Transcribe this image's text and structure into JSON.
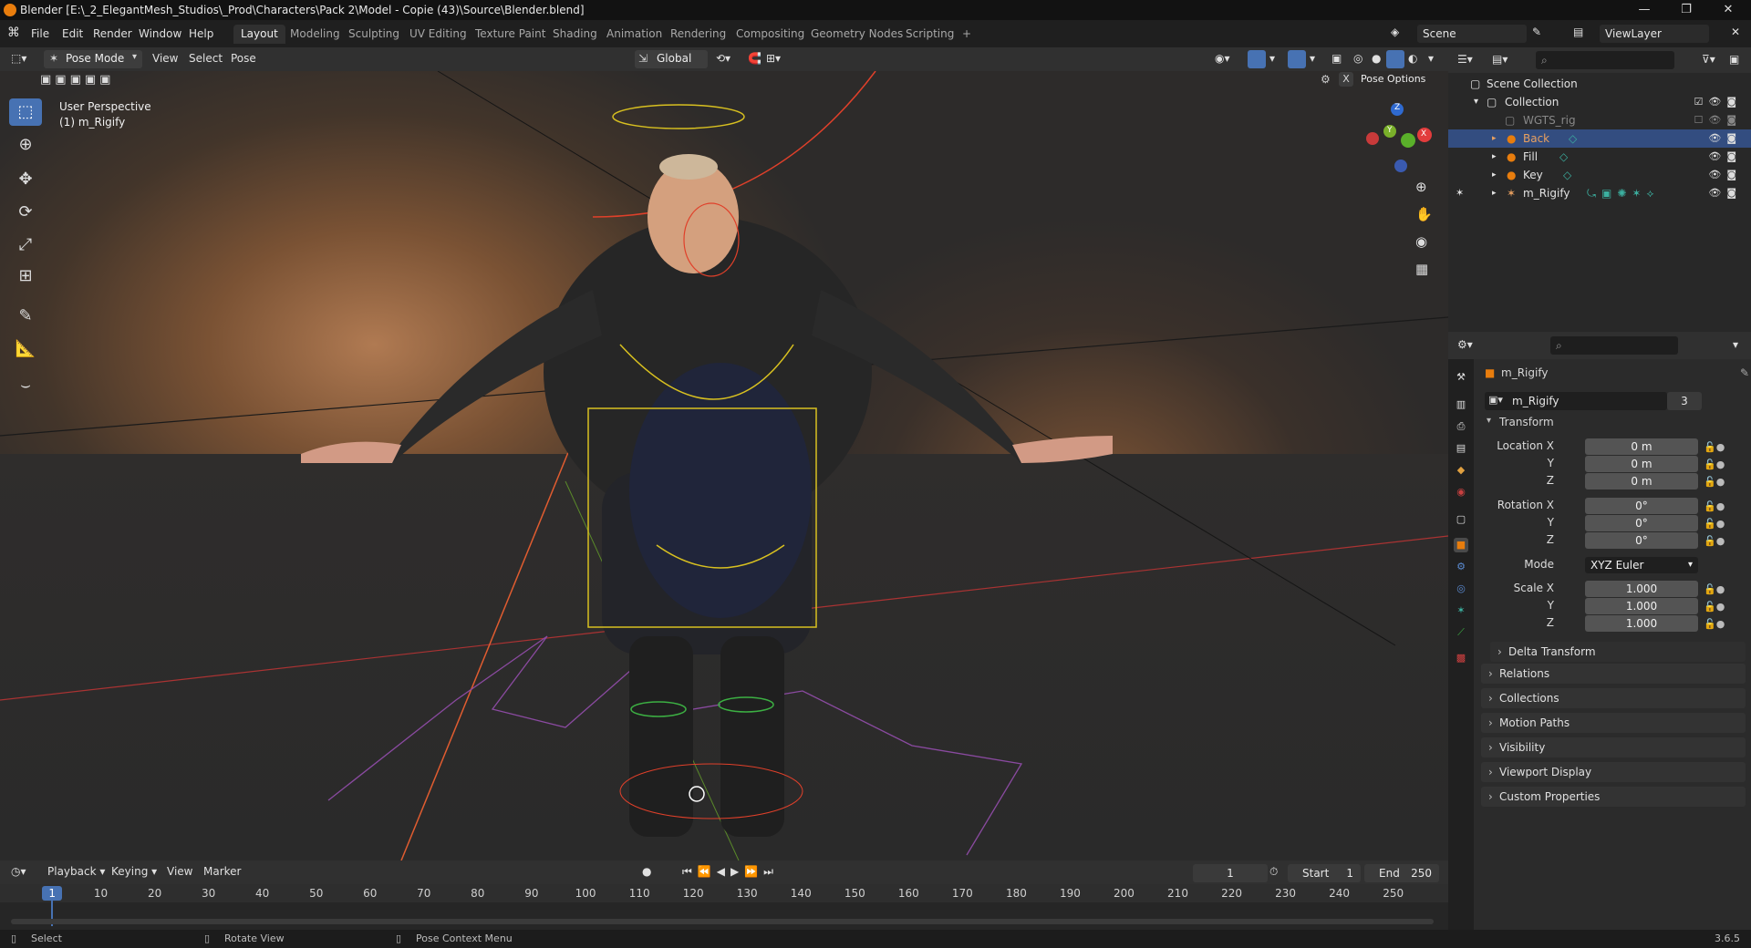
{
  "window": {
    "title": "Blender [E:\\_2_ElegantMesh_Studios\\_Prod\\Characters\\Pack 2\\Model - Copie (43)\\Source\\Blender.blend]"
  },
  "menu": [
    "File",
    "Edit",
    "Render",
    "Window",
    "Help"
  ],
  "workspaces": [
    "Layout",
    "Modeling",
    "Sculpting",
    "UV Editing",
    "Texture Paint",
    "Shading",
    "Animation",
    "Rendering",
    "Compositing",
    "Geometry Nodes",
    "Scripting",
    "+"
  ],
  "scene": {
    "name": "Scene",
    "view_layer": "ViewLayer"
  },
  "viewport_header": {
    "mode": "Pose Mode",
    "menus": [
      "View",
      "Select",
      "Pose"
    ],
    "orientation": "Global",
    "pose_options": "Pose Options",
    "x_toggle": "X"
  },
  "viewport": {
    "overlay_line1": "User Perspective",
    "overlay_line2": "(1) m_Rigify",
    "gizmo": {
      "z": "Z",
      "y": "Y",
      "x": "X"
    }
  },
  "outliner": {
    "rows": [
      {
        "label": "Scene Collection"
      },
      {
        "label": "Collection"
      },
      {
        "label": "WGTS_rig"
      },
      {
        "label": "Back"
      },
      {
        "label": "Fill"
      },
      {
        "label": "Key"
      },
      {
        "label": "m_Rigify"
      }
    ]
  },
  "properties": {
    "object_name": "m_Rigify",
    "data_name": "m_Rigify",
    "users": "3",
    "transform_label": "Transform",
    "location": {
      "label": "Location X",
      "y_label": "Y",
      "z_label": "Z",
      "x": "0 m",
      "y": "0 m",
      "z": "0 m"
    },
    "rotation": {
      "label": "Rotation X",
      "y_label": "Y",
      "z_label": "Z",
      "x": "0°",
      "y": "0°",
      "z": "0°"
    },
    "mode": {
      "label": "Mode",
      "value": "XYZ Euler"
    },
    "scale": {
      "label": "Scale X",
      "y_label": "Y",
      "z_label": "Z",
      "x": "1.000",
      "y": "1.000",
      "z": "1.000"
    },
    "panels": [
      "Delta Transform",
      "Relations",
      "Collections",
      "Motion Paths",
      "Visibility",
      "Viewport Display",
      "Custom Properties"
    ]
  },
  "timeline": {
    "menus": [
      "Playback",
      "Keying",
      "View",
      "Marker"
    ],
    "current_frame": "1",
    "start_label": "Start",
    "start": "1",
    "end_label": "End",
    "end": "250",
    "ticks": [
      "1",
      "10",
      "20",
      "30",
      "40",
      "50",
      "60",
      "70",
      "80",
      "90",
      "100",
      "110",
      "120",
      "130",
      "140",
      "150",
      "160",
      "170",
      "180",
      "190",
      "200",
      "210",
      "220",
      "230",
      "240",
      "250"
    ]
  },
  "statusbar": {
    "select": "Select",
    "rotate": "Rotate View",
    "context": "Pose Context Menu",
    "version": "3.6.5"
  },
  "colors": {
    "accent": "#4772b3",
    "selected_row": "#334d80",
    "bone_yellow": "#d8c020",
    "bone_red": "#e0402a",
    "bone_green": "#3cb043",
    "orange_icon": "#e87d0d"
  }
}
